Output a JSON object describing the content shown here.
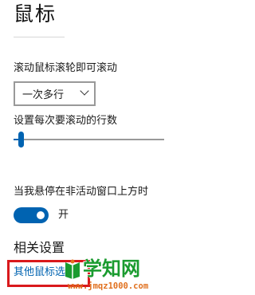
{
  "page": {
    "title": "鼠标"
  },
  "scroll": {
    "label": "滚动鼠标滚轮即可滚动",
    "dropdown_value": "一次多行"
  },
  "lines": {
    "label": "设置每次要滚动的行数",
    "slider_fraction": 0.02
  },
  "inactive_scroll": {
    "label": "当我悬停在非活动窗口上方时",
    "toggle_state": "开",
    "toggle_on": true
  },
  "related": {
    "heading": "相关设置",
    "link": "其他鼠标选项"
  },
  "watermark": {
    "title": "学知网",
    "url": "www.jmqz1000.com",
    "icon": "book-logo-icon"
  },
  "colors": {
    "accent": "#0063b1",
    "highlight_box": "#d9191c",
    "watermark_green": "#1a9b2f",
    "watermark_orange": "#e0701e"
  }
}
